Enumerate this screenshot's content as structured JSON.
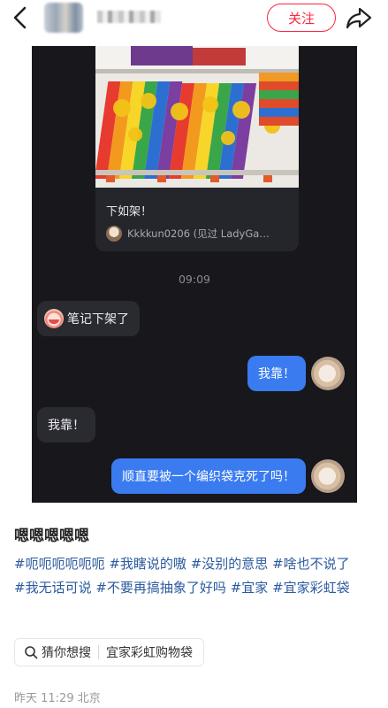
{
  "header": {
    "follow_label": "关注"
  },
  "chat": {
    "card": {
      "title": "下如架！",
      "author": "Kkkkun0206 (见过 LadyGa…"
    },
    "time": "09:09",
    "messages": [
      {
        "side": "in",
        "text": "笔记下架了"
      },
      {
        "side": "out",
        "text": "我靠！"
      },
      {
        "side": "in",
        "text": "我靠！"
      },
      {
        "side": "out",
        "text": "顺直要被一个编织袋克死了吗！"
      }
    ]
  },
  "post": {
    "title": "嗯嗯嗯嗯嗯",
    "tags": [
      "#呃呃呃呃呃呃",
      "#我瞎说的嗷",
      "#没别的意思",
      "#啥也不说了",
      "#我无话可说",
      "#不要再搞抽象了好吗",
      "#宜家",
      "#宜家彩虹袋"
    ],
    "search_label": "猜你想搜",
    "search_query": "宜家彩虹购物袋",
    "meta": "昨天 11:29 北京"
  },
  "colors": {
    "accent": "#ff2442",
    "chat_bg": "#17171c",
    "out_bubble": "#3a7bf0",
    "hashtag": "#2b5a9e"
  }
}
